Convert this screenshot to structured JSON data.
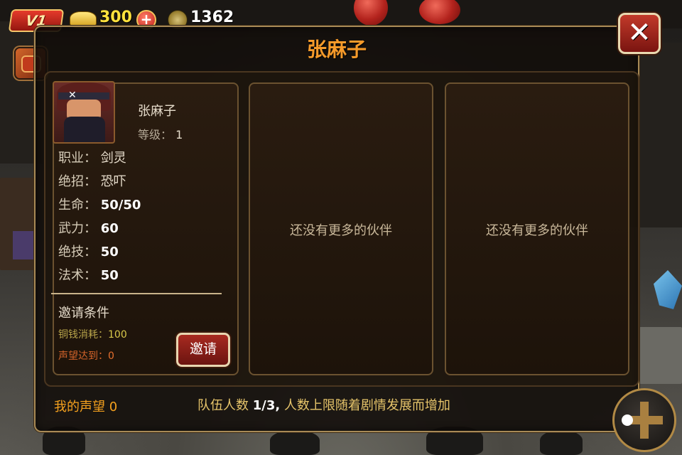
{
  "hud": {
    "vip_label": "V1",
    "gold": "300",
    "plus": "+",
    "coins": "1362"
  },
  "dialog": {
    "title": "张麻子",
    "close_symbol": "✕"
  },
  "hero": {
    "name": "张麻子",
    "level_label": "等级：",
    "level_value": "1",
    "stats": [
      {
        "label": "职业：",
        "value": "剑灵"
      },
      {
        "label": "绝招：",
        "value": "恐吓"
      },
      {
        "label": "生命：",
        "value": "50/50"
      },
      {
        "label": "武力：",
        "value": "60"
      },
      {
        "label": "绝技：",
        "value": "50"
      },
      {
        "label": "法术：",
        "value": "50"
      }
    ],
    "invite_conditions_title": "邀请条件",
    "cost_label": "铜钱消耗：",
    "cost_value": "100",
    "reputation_label": "声望达到：",
    "reputation_value": "0",
    "invite_button": "邀请"
  },
  "slots": [
    {
      "text": "还没有更多的伙伴"
    },
    {
      "text": "还没有更多的伙伴"
    }
  ],
  "footer": {
    "my_reputation_label": "我的声望",
    "my_reputation_value": "0",
    "team_label": "队伍人数",
    "team_value": "1/3,",
    "team_note": "人数上限随着剧情发展而增加"
  },
  "icons": [
    "gold-ingot-icon",
    "plus-icon",
    "coin-icon",
    "drum-icon",
    "close-icon",
    "joystick-icon"
  ],
  "colors": {
    "title_orange": "#f59a2a",
    "panel_border": "#6b5230",
    "button_red": "#a82a20",
    "gold_text": "#ffe23d"
  }
}
